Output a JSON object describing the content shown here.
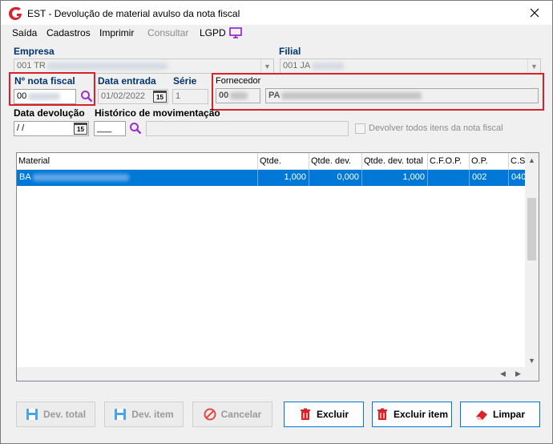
{
  "window": {
    "title": "EST - Devolução de material avulso da nota fiscal"
  },
  "menu": {
    "items": [
      "Saída",
      "Cadastros",
      "Imprimir",
      "Consultar",
      "LGPD"
    ]
  },
  "form": {
    "empresa_label": "Empresa",
    "empresa_value": "001 TR",
    "filial_label": "Filial",
    "filial_value": "001 JA",
    "nota_label": "Nº nota fiscal",
    "nota_value": "00",
    "data_entrada_label": "Data entrada",
    "data_entrada_value": "01/02/2022",
    "serie_label": "Série",
    "serie_value": "1",
    "fornecedor_label": "Fornecedor",
    "fornecedor_code": "00",
    "fornecedor_name": "PA",
    "data_devolucao_label": "Data devolução",
    "data_devolucao_value": " /  /",
    "historico_label": "Histórico de movimentação",
    "historico_code": "___",
    "devolver_todos_label": "Devolver todos itens da nota fiscal",
    "calendar_icon_text": "15"
  },
  "grid": {
    "columns": [
      "Material",
      "Qtde.",
      "Qtde. dev.",
      "Qtde. dev. total",
      "C.F.O.P.",
      "O.P.",
      "C.S"
    ],
    "rows": [
      {
        "material": "BA",
        "qtde": "1,000",
        "qtde_dev": "0,000",
        "qtde_dev_total": "1,000",
        "cfop": "",
        "op": "002",
        "cs": "040"
      }
    ]
  },
  "buttons": {
    "dev_total": "Dev. total",
    "dev_item": "Dev. item",
    "cancelar": "Cancelar",
    "excluir": "Excluir",
    "excluir_item": "Excluir item",
    "limpar": "Limpar"
  },
  "colors": {
    "label_blue": "#003470",
    "selection_blue": "#0078d7",
    "highlight_red": "#d9232a"
  }
}
